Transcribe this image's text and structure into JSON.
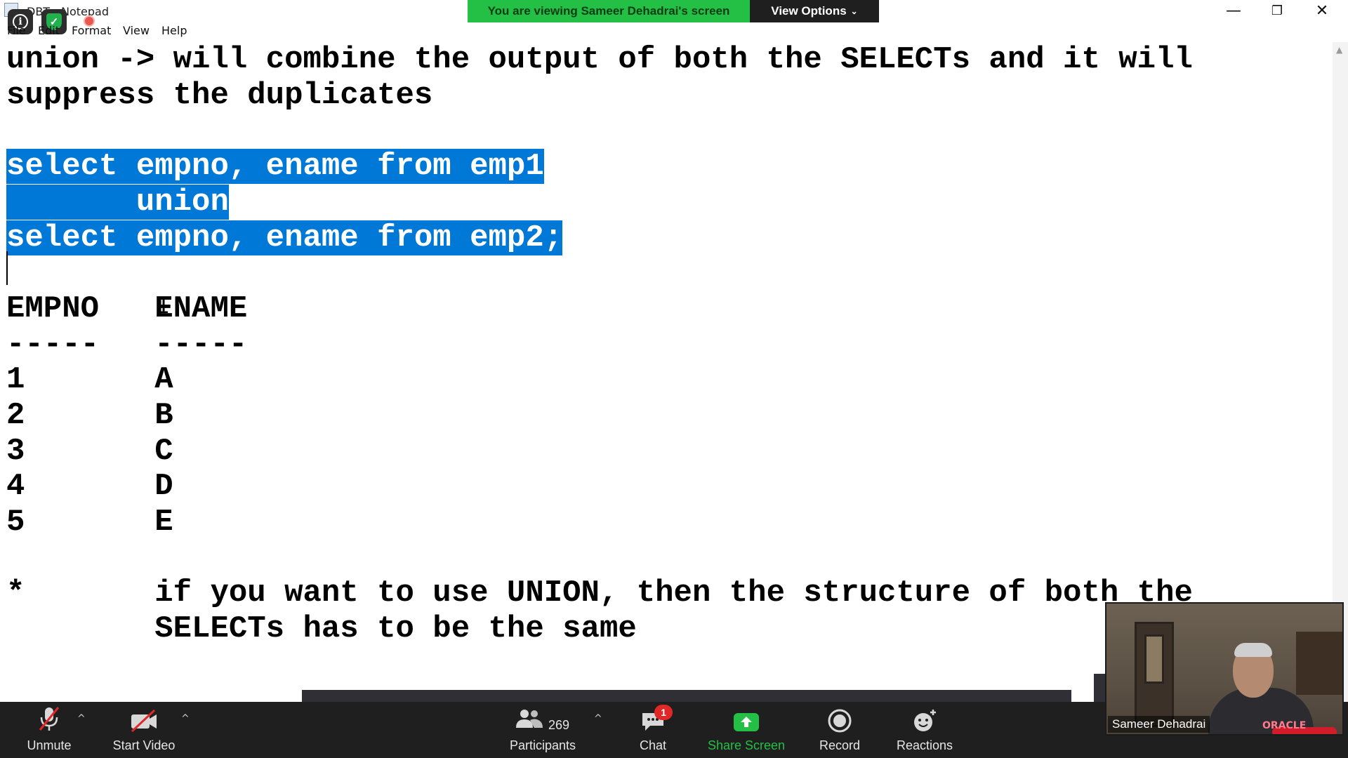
{
  "window": {
    "title": "DBT - Notepad",
    "controls": {
      "minimize": "—",
      "restore": "❐",
      "close": "✕"
    }
  },
  "menu": [
    {
      "label": "File"
    },
    {
      "label": "Edit"
    },
    {
      "label": "Format"
    },
    {
      "label": "View"
    },
    {
      "label": "Help"
    }
  ],
  "share_banner": {
    "message": "You are viewing Sameer Dehadrai's screen",
    "view_options": "View Options",
    "accent": "#23c045"
  },
  "editor": {
    "selection_color": "#0078d7",
    "lines": [
      "union -> will combine the output of both the SELECTs and it will",
      "suppress the duplicates",
      "",
      "select empno, ename from emp1",
      "       union",
      "select empno, ename from emp2;",
      "",
      "EMPNO   ENAME",
      "-----   -----",
      "1       A",
      "2       B",
      "3       C",
      "4       D",
      "5       E",
      "",
      "*       if you want to use UNION, then the structure of both the",
      "        SELECTs has to be the same"
    ]
  },
  "toolbar": {
    "unmute": "Unmute",
    "start_video": "Start Video",
    "participants": "Participants",
    "participants_count": "269",
    "chat": "Chat",
    "chat_badge": "1",
    "share_screen": "Share Screen",
    "record": "Record",
    "reactions": "Reactions"
  },
  "video_tile": {
    "name": "Sameer Dehadrai",
    "shirt_logo": "ORACLE"
  }
}
